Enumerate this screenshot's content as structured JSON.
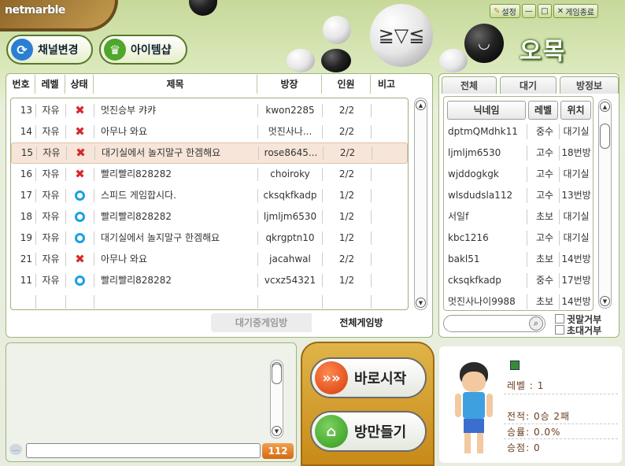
{
  "app": {
    "logo": "netmarble",
    "game_title": "오목"
  },
  "topbar": {
    "settings_label": "설정",
    "minimize": "—",
    "maximize": "□",
    "exit_label": "게임종료"
  },
  "nav": {
    "channel_label": "채널변경",
    "item_shop_label": "아이템샵"
  },
  "room_table": {
    "headers": [
      "번호",
      "레벨",
      "상태",
      "제목",
      "방장",
      "인원",
      "비고"
    ],
    "rows": [
      {
        "num": "13",
        "level": "자유",
        "status": "full",
        "title": "멋진승부 캬캬",
        "host": "kwon2285",
        "players": "2/2",
        "note": "",
        "selected": false
      },
      {
        "num": "14",
        "level": "자유",
        "status": "full",
        "title": "아무나 와요",
        "host": "멋진사나...",
        "players": "2/2",
        "note": "",
        "selected": false
      },
      {
        "num": "15",
        "level": "자유",
        "status": "full",
        "title": "대기실에서 놀지말구 한겜해요",
        "host": "rose8645...",
        "players": "2/2",
        "note": "",
        "selected": true
      },
      {
        "num": "16",
        "level": "자유",
        "status": "full",
        "title": "빨리빨리828282",
        "host": "choiroky",
        "players": "2/2",
        "note": "",
        "selected": false
      },
      {
        "num": "17",
        "level": "자유",
        "status": "open",
        "title": "스피드 게임합시다.",
        "host": "cksqkfkadp",
        "players": "1/2",
        "note": "",
        "selected": false
      },
      {
        "num": "18",
        "level": "자유",
        "status": "open",
        "title": "빨리빨리828282",
        "host": "ljmljm6530",
        "players": "1/2",
        "note": "",
        "selected": false
      },
      {
        "num": "19",
        "level": "자유",
        "status": "open",
        "title": "대기실에서 놀지말구 한겜해요",
        "host": "qkrgptn10",
        "players": "1/2",
        "note": "",
        "selected": false
      },
      {
        "num": "21",
        "level": "자유",
        "status": "full",
        "title": "아무나 와요",
        "host": "jacahwal",
        "players": "2/2",
        "note": "",
        "selected": false
      },
      {
        "num": "11",
        "level": "자유",
        "status": "open",
        "title": "빨리빨리828282",
        "host": "vcxz54321",
        "players": "1/2",
        "note": "",
        "selected": false
      }
    ],
    "bottom_tabs": {
      "waiting": "대기중게임방",
      "all": "전체게임방"
    }
  },
  "user_panel": {
    "tabs": [
      "전체",
      "대기",
      "방정보"
    ],
    "headers": [
      "닉네임",
      "레벨",
      "위치"
    ],
    "users": [
      {
        "nick": "dptmQMdhk11",
        "level": "중수",
        "loc": "대기실"
      },
      {
        "nick": "ljmljm6530",
        "level": "고수",
        "loc": "18번방"
      },
      {
        "nick": "wjddogkgk",
        "level": "고수",
        "loc": "대기실"
      },
      {
        "nick": "wlsdudsla112",
        "level": "고수",
        "loc": "13번방"
      },
      {
        "nick": "서일f",
        "level": "초보",
        "loc": "대기실"
      },
      {
        "nick": "kbc1216",
        "level": "고수",
        "loc": "대기실"
      },
      {
        "nick": "bakl51",
        "level": "초보",
        "loc": "14번방"
      },
      {
        "nick": "cksqkfkadp",
        "level": "중수",
        "loc": "17번방"
      },
      {
        "nick": "멋진사나이9988",
        "level": "초보",
        "loc": "14번방"
      }
    ],
    "search_placeholder": "",
    "options": {
      "whisper_refuse": "귓말거부",
      "invite_refuse": "초대거부"
    }
  },
  "chat": {
    "input_value": "",
    "count_badge": "112"
  },
  "actions": {
    "quick_start": "바로시작",
    "make_room": "방만들기"
  },
  "profile": {
    "level": "레벨 : 1",
    "record": "전적: 0승 2패",
    "winrate": "승률:  0.0%",
    "streak": "승점: 0"
  },
  "colors": {
    "full_status": "#d52a2a",
    "open_status": "#1aa0e6",
    "accent_green": "#4f8a1e",
    "action_gold": "#d9a332"
  }
}
